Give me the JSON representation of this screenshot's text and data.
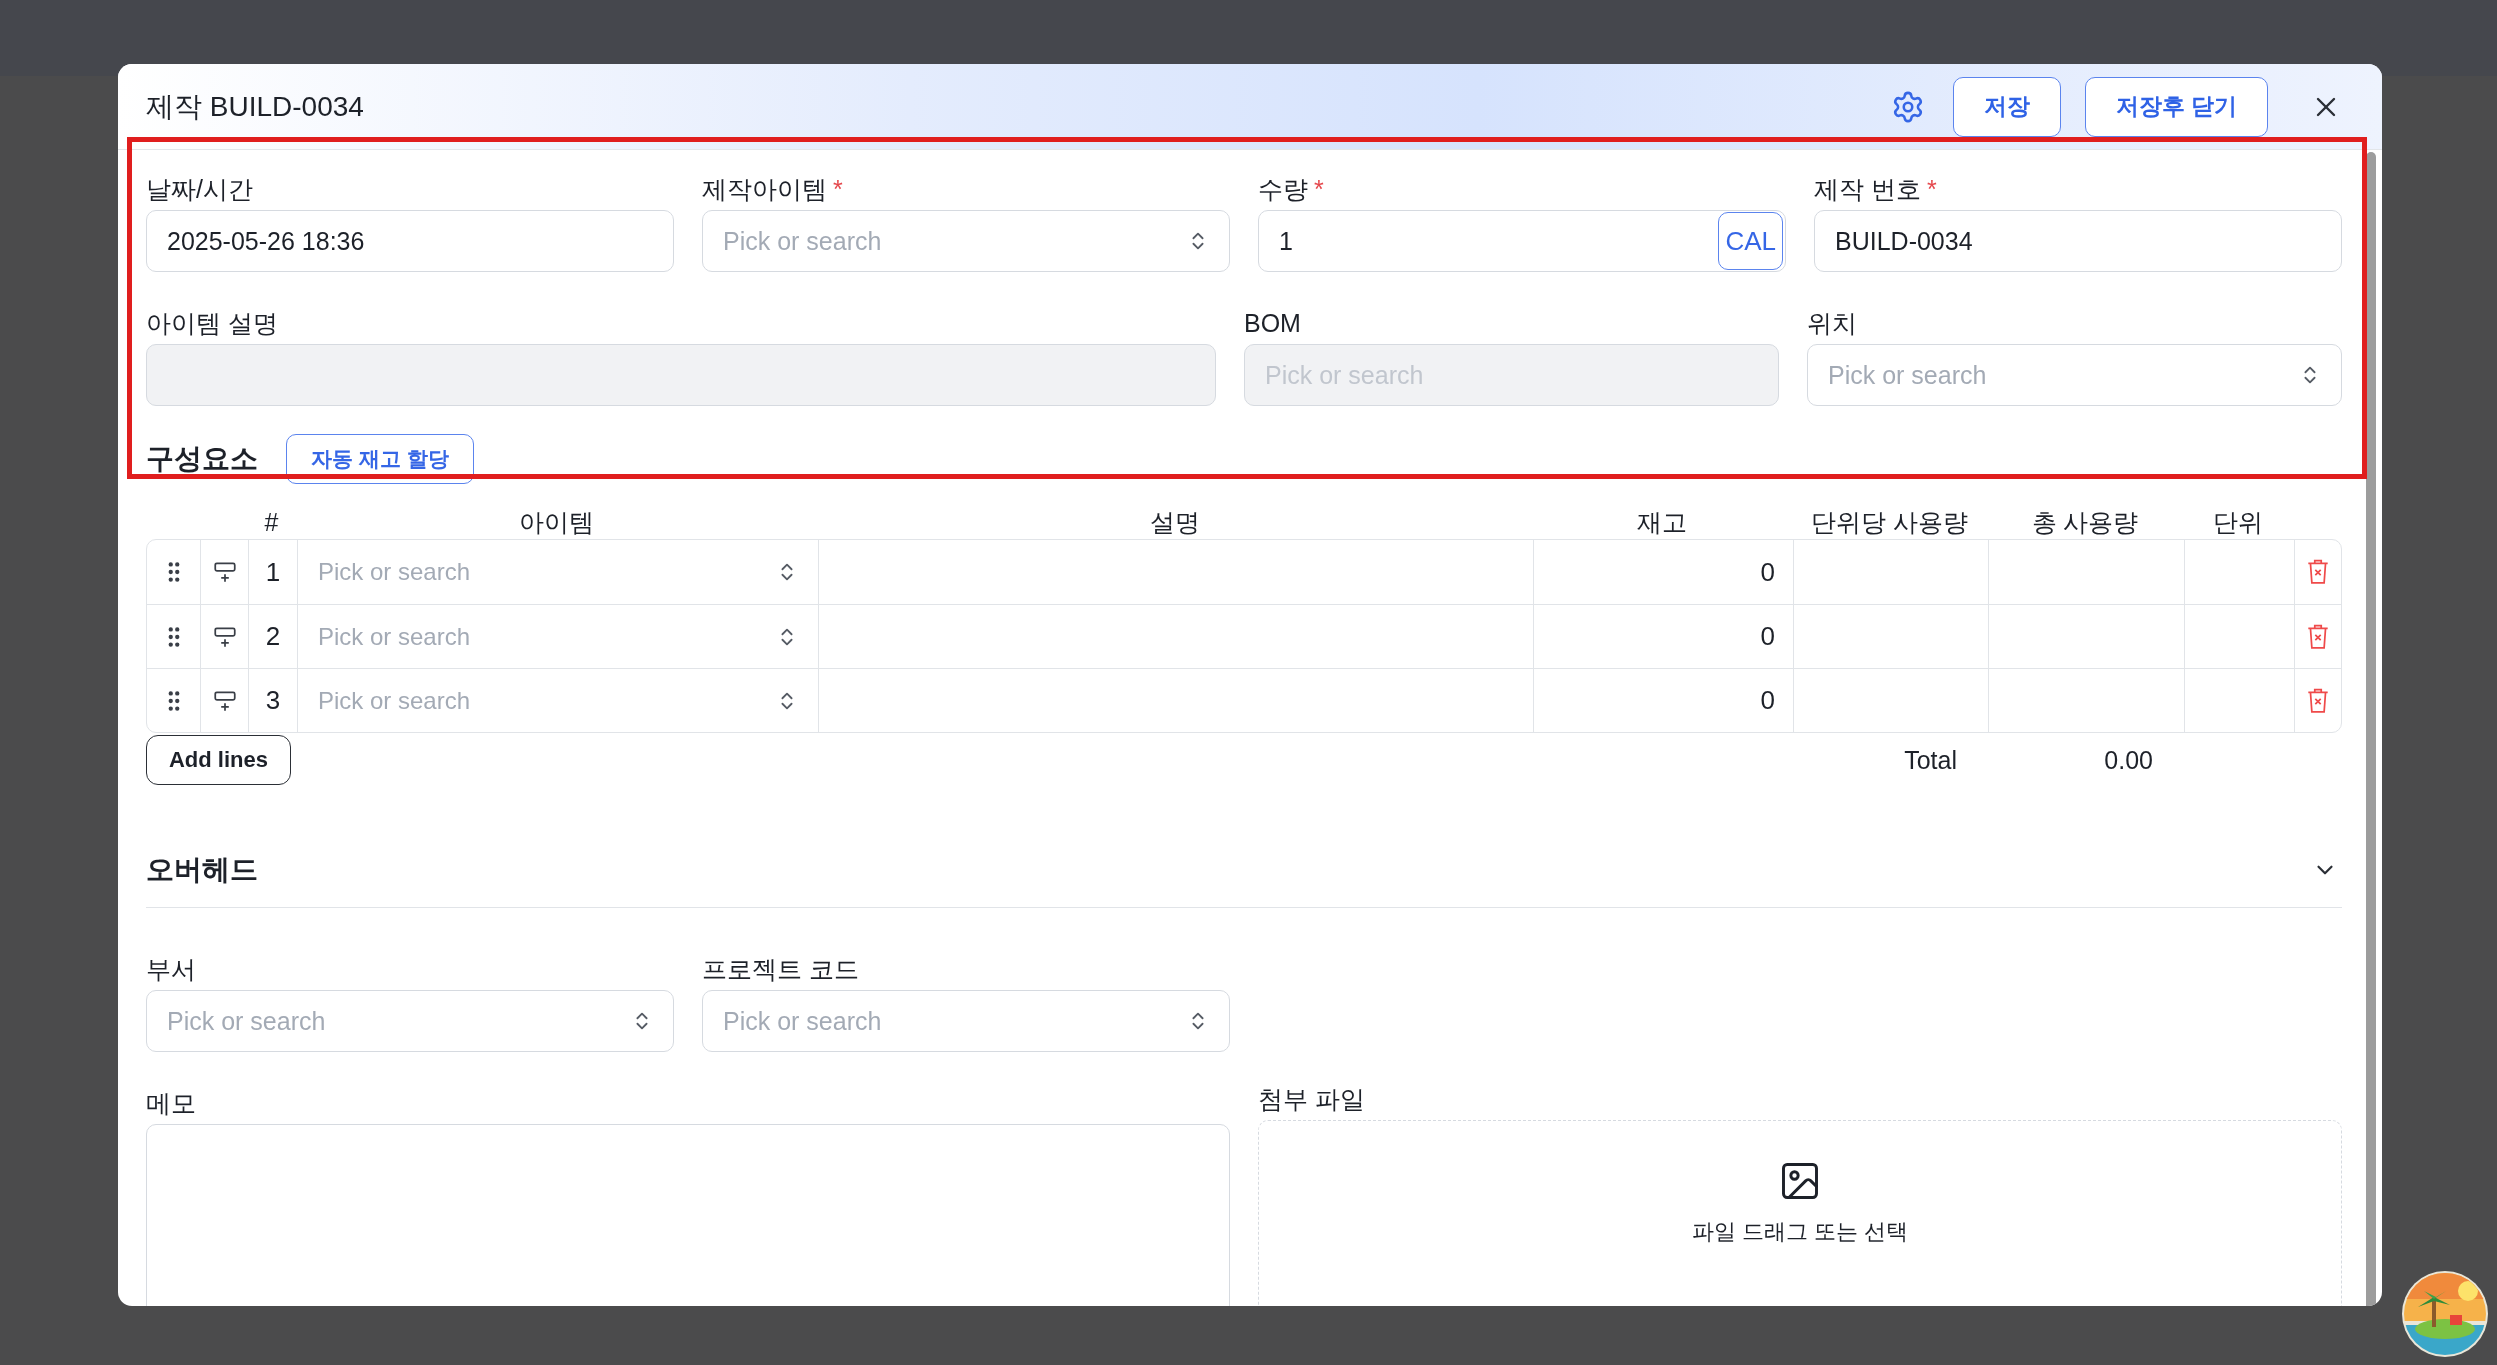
{
  "required_mark": "*",
  "annotation": {
    "kind": "highlight_box",
    "color": "#e01e1e"
  },
  "dialog": {
    "title": "제작 BUILD-0034",
    "buttons": [
      {
        "label": "저장"
      },
      {
        "label": "저장후 닫기"
      }
    ]
  },
  "main_fields": [
    {
      "kind": "text",
      "label": "날짜/시간",
      "required": false,
      "disabled": false,
      "value": "2025-05-26 18:36"
    },
    {
      "kind": "select",
      "label": "제작아이템",
      "required": true,
      "disabled": false,
      "placeholder": "Pick or search"
    },
    {
      "kind": "number_cal",
      "label": "수량",
      "required": true,
      "disabled": false,
      "value": "1",
      "button": "CAL"
    },
    {
      "kind": "text",
      "label": "제작 번호",
      "required": true,
      "disabled": false,
      "value": "BUILD-0034"
    }
  ],
  "detail_fields": [
    {
      "kind": "text",
      "label": "아이템 설명",
      "required": false,
      "disabled": true
    },
    {
      "kind": "select",
      "label": "BOM",
      "required": false,
      "disabled": true,
      "placeholder": "Pick or search"
    },
    {
      "kind": "select",
      "label": "위치",
      "required": false,
      "disabled": false,
      "placeholder": "Pick or search"
    }
  ],
  "components": {
    "title": "구성요소",
    "auto_button": "자동 재고 할당",
    "columns": [
      "#",
      "아이템",
      "설명",
      "재고",
      "단위당 사용량",
      "총 사용량",
      "단위"
    ],
    "rows": [
      {
        "no": "1",
        "item_placeholder": "Pick or search",
        "stock": "0"
      },
      {
        "no": "2",
        "item_placeholder": "Pick or search",
        "stock": "0"
      },
      {
        "no": "3",
        "item_placeholder": "Pick or search",
        "stock": "0"
      }
    ],
    "add_button": "Add lines",
    "total_label": "Total",
    "total_value": "0.00"
  },
  "overhead": {
    "title": "오버헤드",
    "expanded": true,
    "fields": [
      {
        "kind": "select",
        "label": "부서",
        "required": false,
        "disabled": false,
        "placeholder": "Pick or search"
      },
      {
        "kind": "select",
        "label": "프로젝트 코드",
        "required": false,
        "disabled": false,
        "placeholder": "Pick or search"
      }
    ],
    "memo_label": "메모",
    "attachment_label": "첨부 파일",
    "drop_text": "파일 드래그 또는 선택"
  }
}
